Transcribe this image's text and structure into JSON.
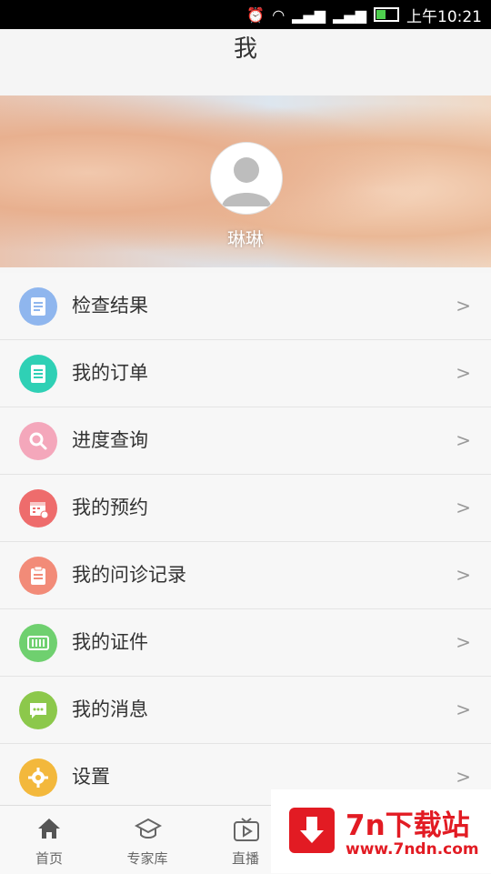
{
  "status_bar": {
    "time": "上午10:21"
  },
  "header": {
    "title": "我"
  },
  "profile": {
    "name": "琳琳"
  },
  "menu": [
    {
      "label": "检查结果",
      "icon": "report-icon",
      "color": "#8fb6ee"
    },
    {
      "label": "我的订单",
      "icon": "order-icon",
      "color": "#2fd0b5"
    },
    {
      "label": "进度查询",
      "icon": "search-icon",
      "color": "#f4a7bb"
    },
    {
      "label": "我的预约",
      "icon": "calendar-icon",
      "color": "#ee6c6c"
    },
    {
      "label": "我的问诊记录",
      "icon": "clipboard-icon",
      "color": "#f28b78"
    },
    {
      "label": "我的证件",
      "icon": "id-card-icon",
      "color": "#6fd06f"
    },
    {
      "label": "我的消息",
      "icon": "message-icon",
      "color": "#8cc84b"
    },
    {
      "label": "设置",
      "icon": "gear-icon",
      "color": "#f3b83c"
    }
  ],
  "tabbar": [
    {
      "label": "首页",
      "icon": "home-icon"
    },
    {
      "label": "专家库",
      "icon": "graduation-cap-icon"
    },
    {
      "label": "直播",
      "icon": "tv-play-icon"
    }
  ],
  "watermark": {
    "title": "7n下载站",
    "url": "www.7ndn.com"
  }
}
